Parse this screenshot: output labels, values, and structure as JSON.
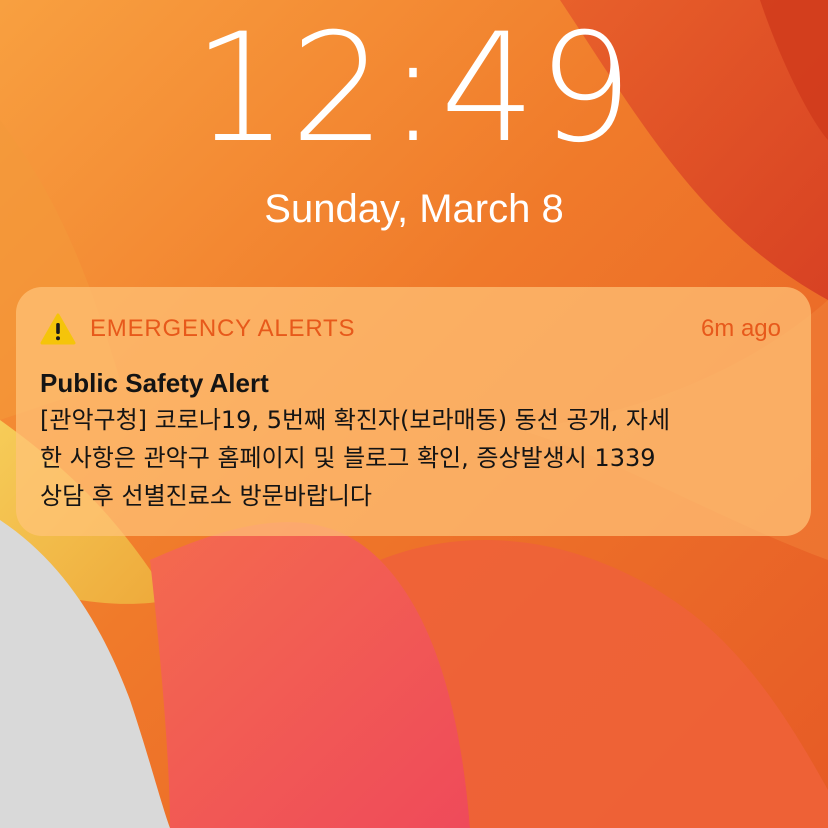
{
  "lock_screen": {
    "time": "12:49",
    "date": "Sunday, March 8"
  },
  "notification": {
    "app_name": "EMERGENCY ALERTS",
    "app_icon": "warning-icon",
    "time_ago": "6m ago",
    "title": "Public Safety Alert",
    "body_lines": [
      "[관악구청] 코로나19, 5번째 확진자(보라매동) 동선 공개, 자세",
      "한 사항은 관악구 홈페이지 및 블로그 확인, 증상발생시 1339",
      "상담 후 선별진료소 방문바랍니다"
    ]
  },
  "colors": {
    "wallpaper_orange": "#f07a2a",
    "wallpaper_red": "#e4452a",
    "wallpaper_yellow": "#f4c04a",
    "wallpaper_gray": "#d8d8d8",
    "accent": "#e7591b",
    "notification_bg": "#ffc478"
  }
}
